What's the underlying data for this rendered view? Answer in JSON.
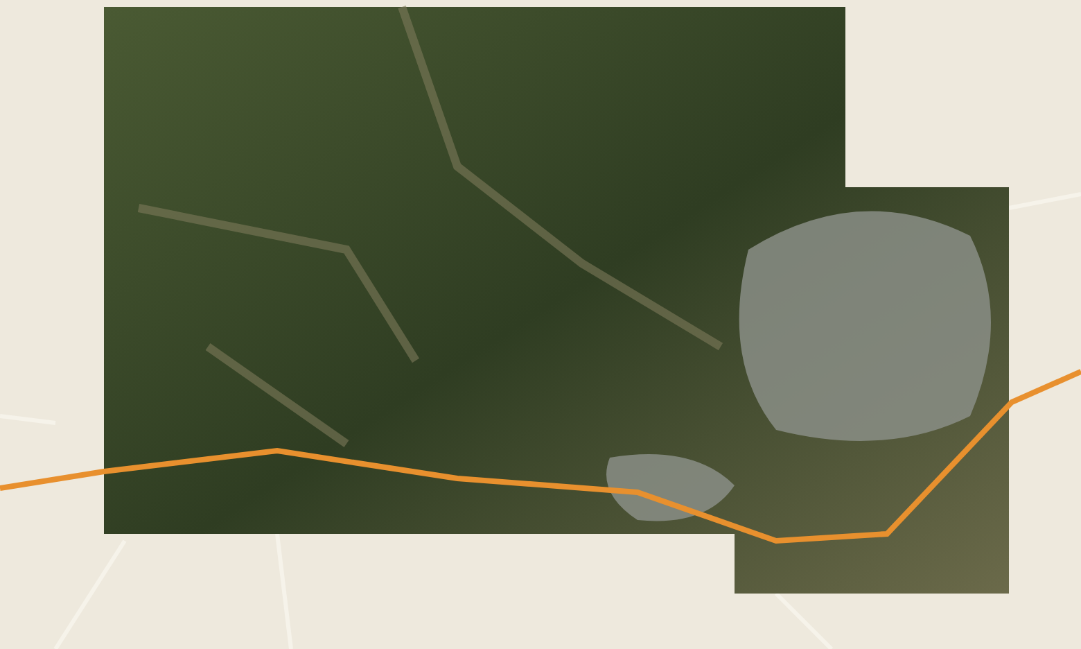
{
  "map": {
    "road_map": true,
    "satellite": true,
    "highways": true,
    "city": true
  }
}
